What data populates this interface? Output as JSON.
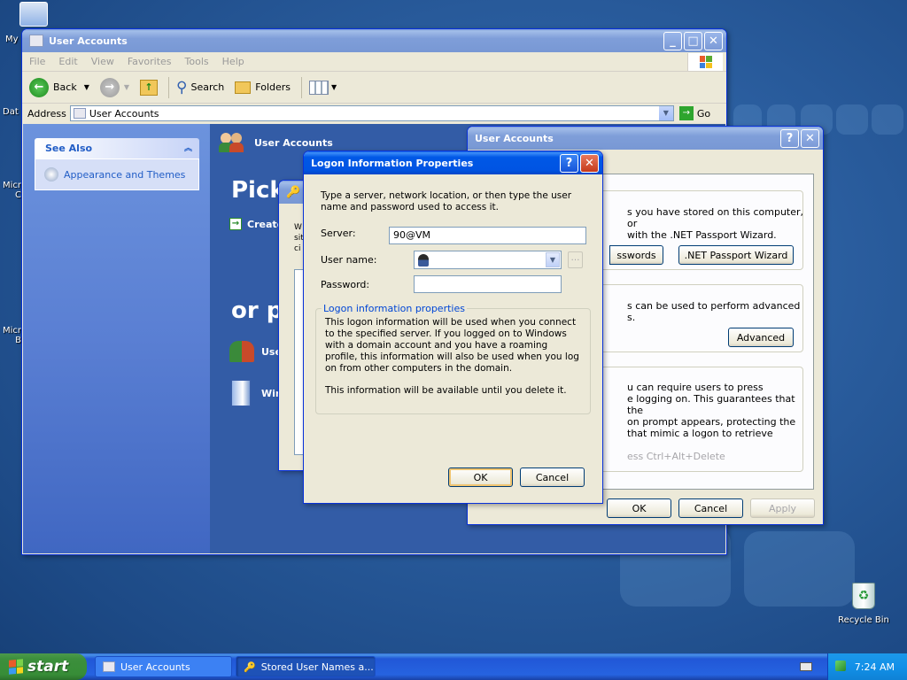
{
  "desktop": {
    "icons": [
      {
        "label": "My"
      },
      {
        "label": "Dat"
      },
      {
        "label": "Micr\nC"
      },
      {
        "label": "Micr\nB"
      }
    ],
    "recycle_bin": "Recycle Bin"
  },
  "explorer": {
    "title": "User Accounts",
    "menu": [
      "File",
      "Edit",
      "View",
      "Favorites",
      "Tools",
      "Help"
    ],
    "toolbar": {
      "back": "Back",
      "search": "Search",
      "folders": "Folders"
    },
    "address_label": "Address",
    "address_value": "User Accounts",
    "go": "Go",
    "see_also_title": "See Also",
    "see_also_link": "Appearance and Themes",
    "header": "User Accounts",
    "pick_partial": "Pick",
    "create_partial": "Create",
    "or_partial": "or pi",
    "task1_partial": "Use",
    "task2_partial": "Wir"
  },
  "stored_dialog": {
    "w_fragment": "W\nsit\nci",
    "en_fragment": "en"
  },
  "ua_dialog": {
    "title": "User Accounts",
    "text1": "s you have stored on this computer, or\nwith the .NET Passport Wizard.",
    "btn_passwords": "sswords",
    "btn_passport": ".NET Passport Wizard",
    "text2": "s can be used to perform advanced\ns.",
    "btn_advanced": "Advanced",
    "text3": "u can require users to press\ne logging on. This guarantees that the\non prompt appears, protecting the\nthat mimic a logon to retrieve",
    "cad": "ess Ctrl+Alt+Delete",
    "ok": "OK",
    "cancel": "Cancel",
    "apply": "Apply"
  },
  "logon_dialog": {
    "title": "Logon Information Properties",
    "intro": "Type a server, network location, or then type the user name and password used to access it.",
    "server_label": "Server:",
    "server_value": "90@VM",
    "username_label": "User name:",
    "username_value": "",
    "password_label": "Password:",
    "group_title": "Logon information properties",
    "group_text1": "This logon information will be used when you connect to the specified server. If you logged on to Windows with a domain account and you have a roaming profile, this information will also be used when you log on from other computers in the domain.",
    "group_text2": "This information will be available until you delete it.",
    "ok": "OK",
    "cancel": "Cancel"
  },
  "taskbar": {
    "start": "start",
    "tasks": [
      "User Accounts",
      "Stored User Names a..."
    ],
    "clock": "7:24 AM"
  }
}
